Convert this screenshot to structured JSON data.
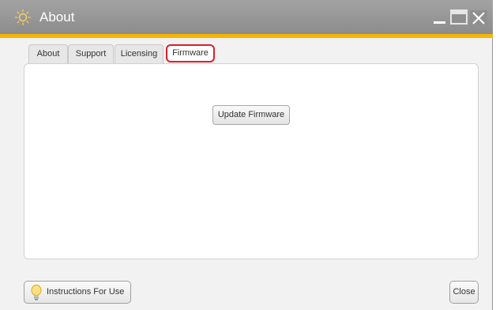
{
  "window": {
    "title": "About",
    "accent_color": "#f7b400",
    "icon": "sun-logo-icon",
    "controls": [
      "minimize-icon",
      "maximize-icon",
      "close-icon"
    ]
  },
  "tabs": [
    {
      "label": "About",
      "active": false
    },
    {
      "label": "Support",
      "active": false
    },
    {
      "label": "Licensing",
      "active": false
    },
    {
      "label": "Firmware",
      "active": true
    }
  ],
  "highlight_color": "#d8212b",
  "panel": {
    "update_button_label": "Update Firmware"
  },
  "footer": {
    "instructions_label": "Instructions For Use",
    "instructions_icon": "lightbulb-icon",
    "close_label": "Close"
  }
}
